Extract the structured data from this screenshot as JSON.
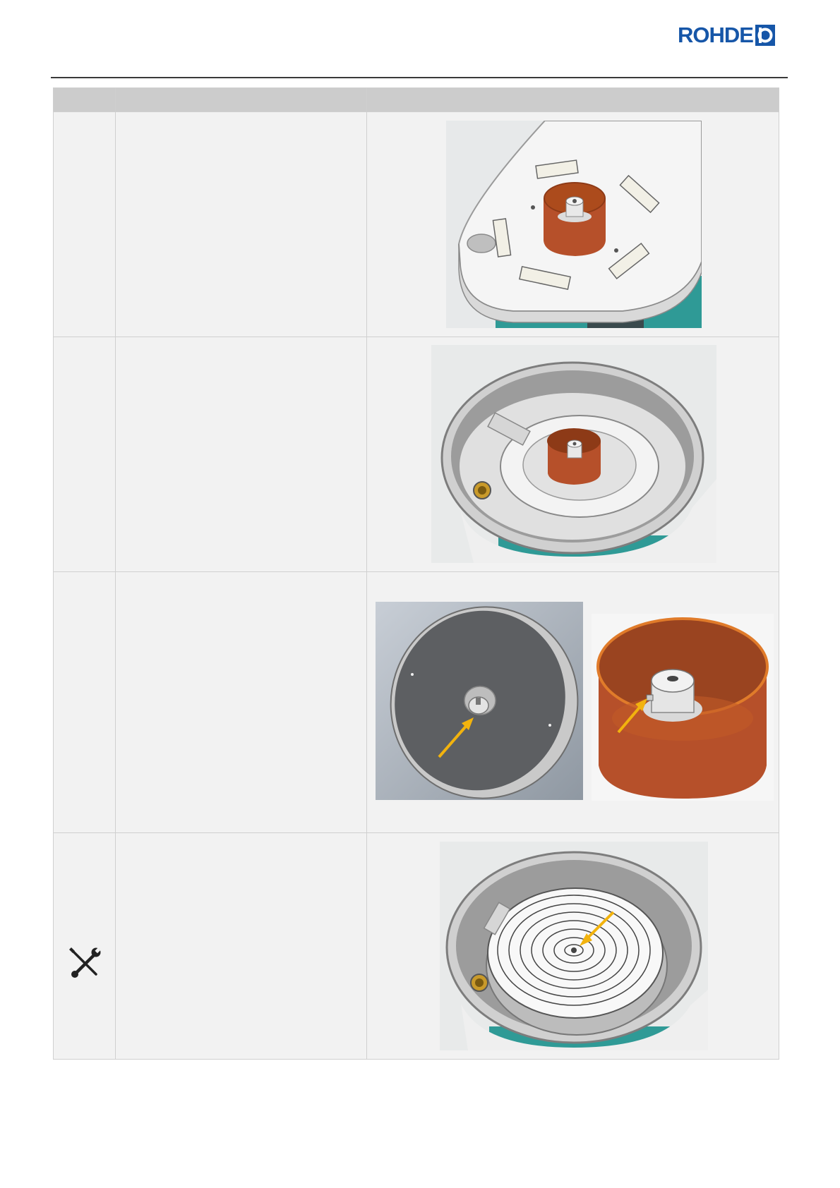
{
  "header": {
    "brand": "ROHDE",
    "brand_color": "#1656a8"
  },
  "table": {
    "columns": [
      "",
      "",
      ""
    ],
    "rows": [
      {
        "step": "",
        "text": "",
        "figures": [
          "plate-with-magnetic-strips"
        ]
      },
      {
        "step": "",
        "text": "",
        "figures": [
          "splash-pan-with-orange-hub"
        ]
      },
      {
        "step": "",
        "text": "",
        "figures": [
          "wheel-head-underside-with-notch",
          "orange-hub-with-pin"
        ]
      },
      {
        "step": "",
        "text": "",
        "figures": [
          "wheel-head-mounted-center-screw"
        ],
        "icon": "tools-icon"
      }
    ]
  },
  "colors": {
    "accent_orange": "#c2571f",
    "arrow_yellow": "#f2b30e",
    "frame_teal": "#2f9a96",
    "header_grey": "#cccccc",
    "cell_grey": "#f2f2f2"
  }
}
